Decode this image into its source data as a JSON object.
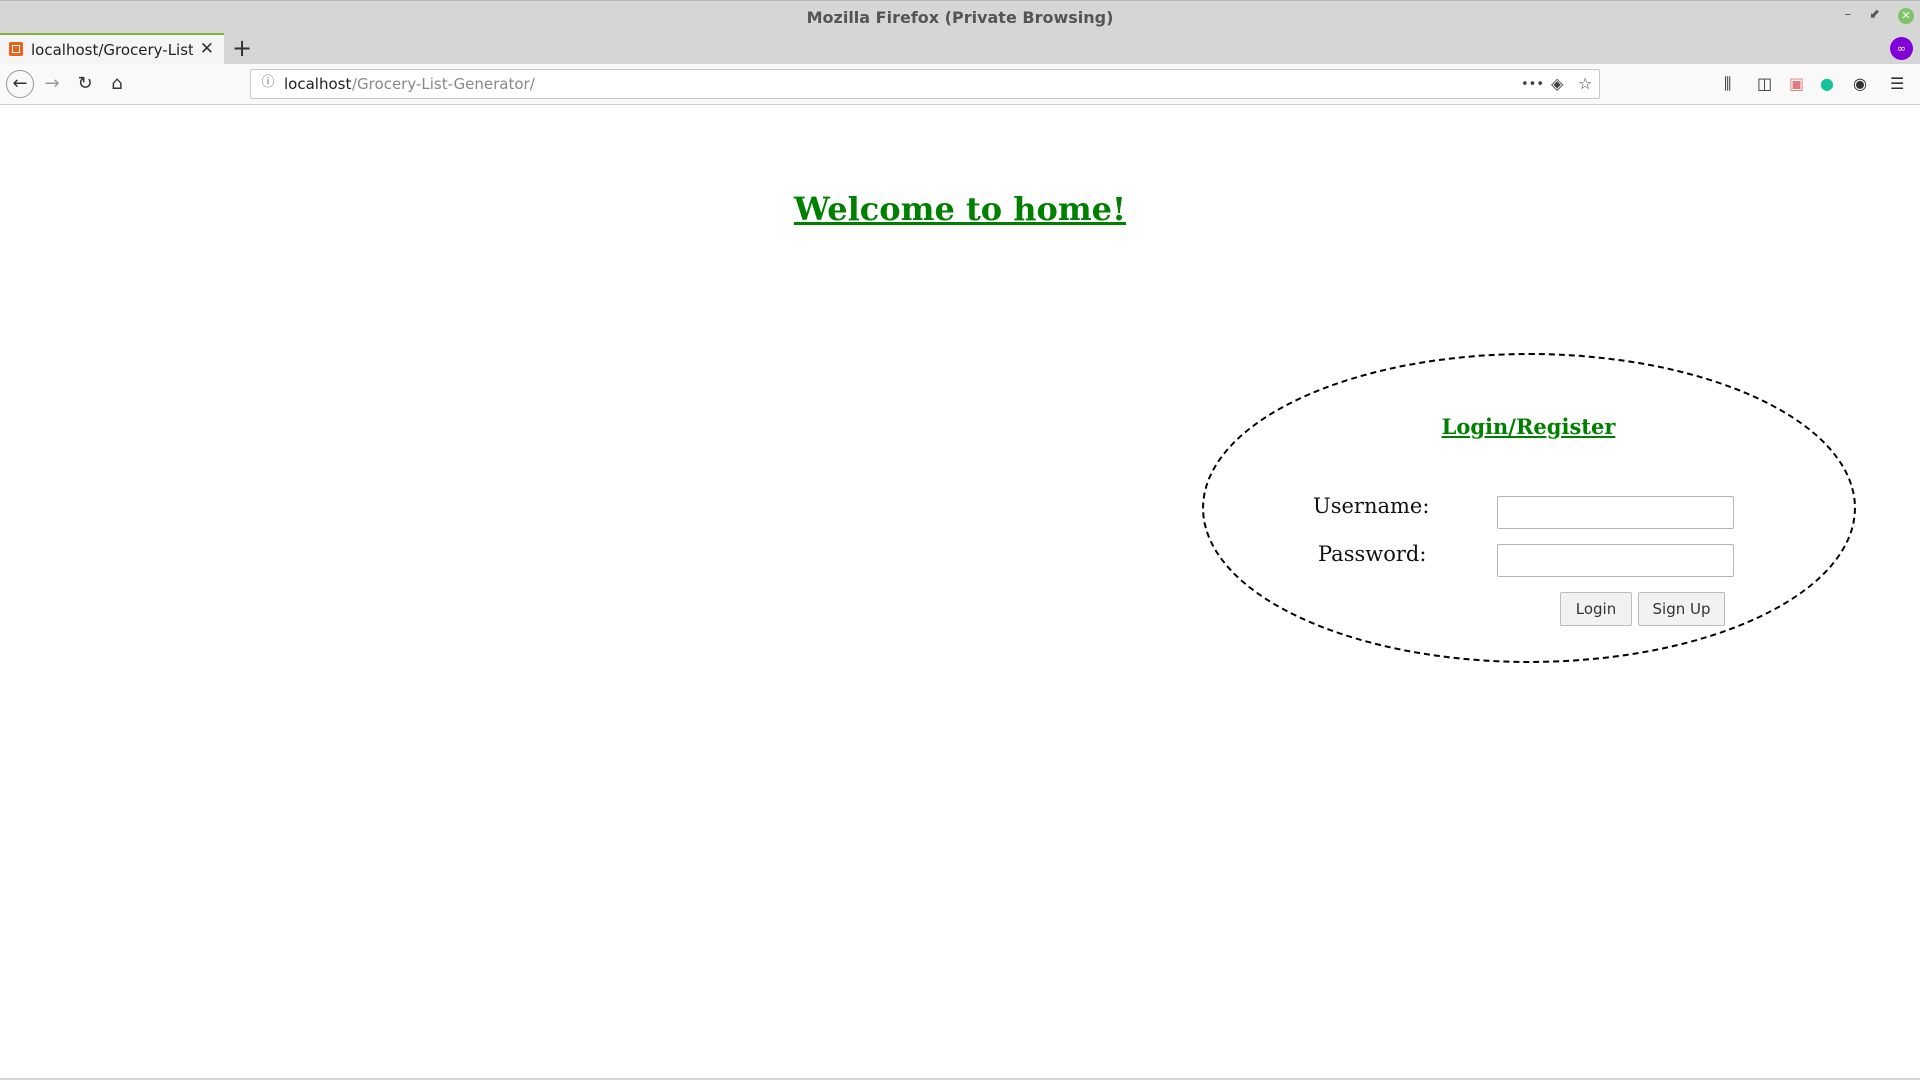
{
  "window": {
    "title": "Mozilla Firefox (Private Browsing)",
    "minimize_glyph": "–",
    "restore_glyph": "⬋",
    "close_glyph": "✕"
  },
  "tabs": [
    {
      "label": "localhost/Grocery-List-Generator/",
      "favicon": "xampp-icon",
      "close_glyph": "✕"
    }
  ],
  "new_tab_glyph": "+",
  "private_icon_glyph": "∞",
  "navbar": {
    "back_glyph": "←",
    "forward_glyph": "→",
    "reload_glyph": "↻",
    "home_glyph": "⌂",
    "url_host": "localhost",
    "url_path": "/Grocery-List-Generator/",
    "page_actions_glyph": "•••",
    "pocket_glyph": "◈",
    "bookmark_glyph": "☆",
    "toolbar_icons": [
      "library-icon",
      "sidebar-icon",
      "extension-icon",
      "grammarly-icon",
      "account-icon",
      "menu-icon"
    ]
  },
  "page": {
    "heading": "Welcome to home!",
    "login_title": "Login/Register",
    "username_label": "Username:",
    "password_label": "Password:",
    "username_value": "",
    "password_value": "",
    "login_button": "Login",
    "signup_button": "Sign Up"
  },
  "colors": {
    "heading_green": "#008000",
    "private_purple": "#8000d7",
    "tab_accent": "#7fb640"
  }
}
